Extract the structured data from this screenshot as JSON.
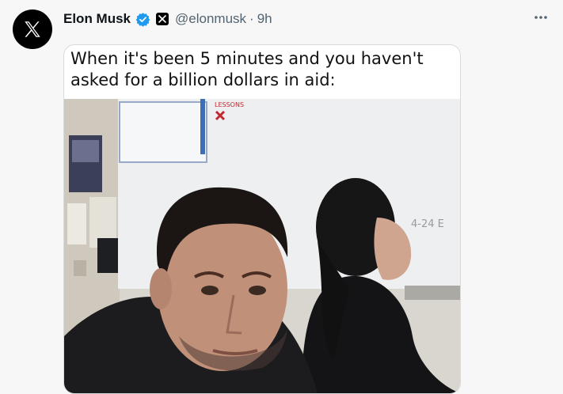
{
  "tweet": {
    "author_name": "Elon Musk",
    "handle": "@elonmusk",
    "separator": "·",
    "time": "9h",
    "more_label": "···"
  },
  "meme": {
    "caption": "When it's been 5 minutes and you haven't asked for a billion dollars in aid:",
    "board_text_1": "4-24 E",
    "board_sign": "LESSONS"
  },
  "colors": {
    "verified_blue": "#1d9bf0",
    "muted_text": "#536471",
    "background": "#f7f7f7"
  },
  "icons": [
    "x-logo-icon",
    "verified-badge-icon",
    "x-affiliate-badge-icon",
    "more-options-icon"
  ]
}
